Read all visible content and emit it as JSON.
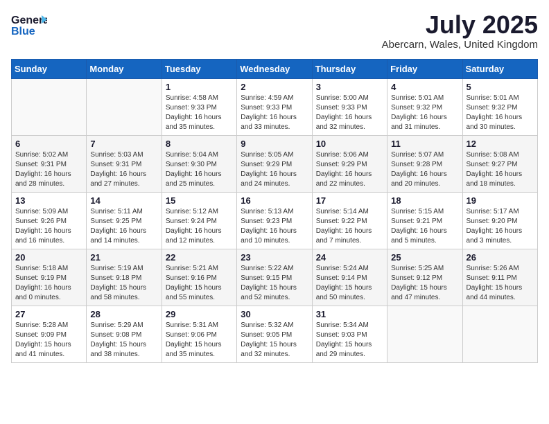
{
  "header": {
    "logo_line1": "General",
    "logo_line2": "Blue",
    "month_year": "July 2025",
    "location": "Abercarn, Wales, United Kingdom"
  },
  "weekdays": [
    "Sunday",
    "Monday",
    "Tuesday",
    "Wednesday",
    "Thursday",
    "Friday",
    "Saturday"
  ],
  "weeks": [
    [
      {
        "day": "",
        "info": ""
      },
      {
        "day": "",
        "info": ""
      },
      {
        "day": "1",
        "info": "Sunrise: 4:58 AM\nSunset: 9:33 PM\nDaylight: 16 hours\nand 35 minutes."
      },
      {
        "day": "2",
        "info": "Sunrise: 4:59 AM\nSunset: 9:33 PM\nDaylight: 16 hours\nand 33 minutes."
      },
      {
        "day": "3",
        "info": "Sunrise: 5:00 AM\nSunset: 9:33 PM\nDaylight: 16 hours\nand 32 minutes."
      },
      {
        "day": "4",
        "info": "Sunrise: 5:01 AM\nSunset: 9:32 PM\nDaylight: 16 hours\nand 31 minutes."
      },
      {
        "day": "5",
        "info": "Sunrise: 5:01 AM\nSunset: 9:32 PM\nDaylight: 16 hours\nand 30 minutes."
      }
    ],
    [
      {
        "day": "6",
        "info": "Sunrise: 5:02 AM\nSunset: 9:31 PM\nDaylight: 16 hours\nand 28 minutes."
      },
      {
        "day": "7",
        "info": "Sunrise: 5:03 AM\nSunset: 9:31 PM\nDaylight: 16 hours\nand 27 minutes."
      },
      {
        "day": "8",
        "info": "Sunrise: 5:04 AM\nSunset: 9:30 PM\nDaylight: 16 hours\nand 25 minutes."
      },
      {
        "day": "9",
        "info": "Sunrise: 5:05 AM\nSunset: 9:29 PM\nDaylight: 16 hours\nand 24 minutes."
      },
      {
        "day": "10",
        "info": "Sunrise: 5:06 AM\nSunset: 9:29 PM\nDaylight: 16 hours\nand 22 minutes."
      },
      {
        "day": "11",
        "info": "Sunrise: 5:07 AM\nSunset: 9:28 PM\nDaylight: 16 hours\nand 20 minutes."
      },
      {
        "day": "12",
        "info": "Sunrise: 5:08 AM\nSunset: 9:27 PM\nDaylight: 16 hours\nand 18 minutes."
      }
    ],
    [
      {
        "day": "13",
        "info": "Sunrise: 5:09 AM\nSunset: 9:26 PM\nDaylight: 16 hours\nand 16 minutes."
      },
      {
        "day": "14",
        "info": "Sunrise: 5:11 AM\nSunset: 9:25 PM\nDaylight: 16 hours\nand 14 minutes."
      },
      {
        "day": "15",
        "info": "Sunrise: 5:12 AM\nSunset: 9:24 PM\nDaylight: 16 hours\nand 12 minutes."
      },
      {
        "day": "16",
        "info": "Sunrise: 5:13 AM\nSunset: 9:23 PM\nDaylight: 16 hours\nand 10 minutes."
      },
      {
        "day": "17",
        "info": "Sunrise: 5:14 AM\nSunset: 9:22 PM\nDaylight: 16 hours\nand 7 minutes."
      },
      {
        "day": "18",
        "info": "Sunrise: 5:15 AM\nSunset: 9:21 PM\nDaylight: 16 hours\nand 5 minutes."
      },
      {
        "day": "19",
        "info": "Sunrise: 5:17 AM\nSunset: 9:20 PM\nDaylight: 16 hours\nand 3 minutes."
      }
    ],
    [
      {
        "day": "20",
        "info": "Sunrise: 5:18 AM\nSunset: 9:19 PM\nDaylight: 16 hours\nand 0 minutes."
      },
      {
        "day": "21",
        "info": "Sunrise: 5:19 AM\nSunset: 9:18 PM\nDaylight: 15 hours\nand 58 minutes."
      },
      {
        "day": "22",
        "info": "Sunrise: 5:21 AM\nSunset: 9:16 PM\nDaylight: 15 hours\nand 55 minutes."
      },
      {
        "day": "23",
        "info": "Sunrise: 5:22 AM\nSunset: 9:15 PM\nDaylight: 15 hours\nand 52 minutes."
      },
      {
        "day": "24",
        "info": "Sunrise: 5:24 AM\nSunset: 9:14 PM\nDaylight: 15 hours\nand 50 minutes."
      },
      {
        "day": "25",
        "info": "Sunrise: 5:25 AM\nSunset: 9:12 PM\nDaylight: 15 hours\nand 47 minutes."
      },
      {
        "day": "26",
        "info": "Sunrise: 5:26 AM\nSunset: 9:11 PM\nDaylight: 15 hours\nand 44 minutes."
      }
    ],
    [
      {
        "day": "27",
        "info": "Sunrise: 5:28 AM\nSunset: 9:09 PM\nDaylight: 15 hours\nand 41 minutes."
      },
      {
        "day": "28",
        "info": "Sunrise: 5:29 AM\nSunset: 9:08 PM\nDaylight: 15 hours\nand 38 minutes."
      },
      {
        "day": "29",
        "info": "Sunrise: 5:31 AM\nSunset: 9:06 PM\nDaylight: 15 hours\nand 35 minutes."
      },
      {
        "day": "30",
        "info": "Sunrise: 5:32 AM\nSunset: 9:05 PM\nDaylight: 15 hours\nand 32 minutes."
      },
      {
        "day": "31",
        "info": "Sunrise: 5:34 AM\nSunset: 9:03 PM\nDaylight: 15 hours\nand 29 minutes."
      },
      {
        "day": "",
        "info": ""
      },
      {
        "day": "",
        "info": ""
      }
    ]
  ]
}
